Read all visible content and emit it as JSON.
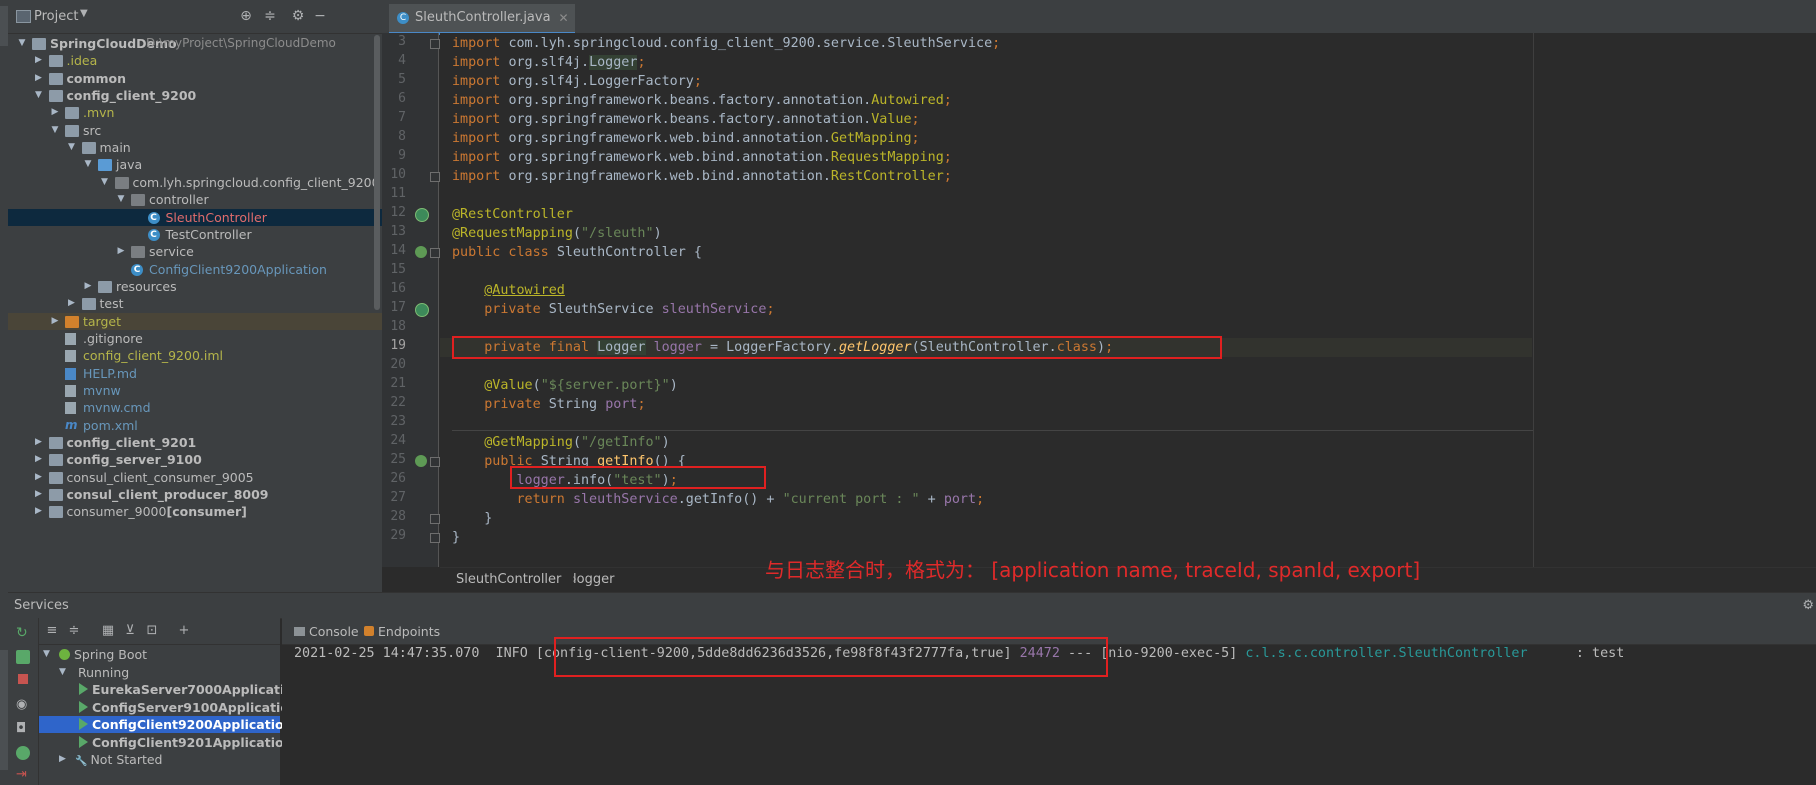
{
  "project_panel": {
    "title": "Project",
    "tree": [
      {
        "label": "SpringCloudDemo",
        "path": "D:\\myProject\\SpringCloudDemo",
        "depth": 0,
        "arrow": "▼",
        "icon": "folder",
        "bold": true,
        "color": "#bbbbbb"
      },
      {
        "label": ".idea",
        "depth": 1,
        "arrow": "▶",
        "icon": "folder",
        "color": "#b5b54a"
      },
      {
        "label": "common",
        "depth": 1,
        "arrow": "▶",
        "icon": "folder",
        "bold": true,
        "color": "#bbbbbb"
      },
      {
        "label": "config_client_9200",
        "depth": 1,
        "arrow": "▼",
        "icon": "folder",
        "bold": true,
        "color": "#bbbbbb"
      },
      {
        "label": ".mvn",
        "depth": 2,
        "arrow": "▶",
        "icon": "folder",
        "color": "#b5b54a"
      },
      {
        "label": "src",
        "depth": 2,
        "arrow": "▼",
        "icon": "folder",
        "color": "#bbbbbb"
      },
      {
        "label": "main",
        "depth": 3,
        "arrow": "▼",
        "icon": "folder",
        "color": "#bbbbbb"
      },
      {
        "label": "java",
        "depth": 4,
        "arrow": "▼",
        "icon": "folder-src",
        "color": "#bbbbbb"
      },
      {
        "label": "com.lyh.springcloud.config_client_9200",
        "depth": 5,
        "arrow": "▼",
        "icon": "package",
        "color": "#bbbbbb"
      },
      {
        "label": "controller",
        "depth": 6,
        "arrow": "▼",
        "icon": "package",
        "color": "#bbbbbb"
      },
      {
        "label": "SleuthController",
        "depth": 7,
        "arrow": "",
        "icon": "class",
        "color": "#e06c6c",
        "selected": true
      },
      {
        "label": "TestController",
        "depth": 7,
        "arrow": "",
        "icon": "class",
        "color": "#bbbbbb"
      },
      {
        "label": "service",
        "depth": 6,
        "arrow": "▶",
        "icon": "package",
        "color": "#bbbbbb"
      },
      {
        "label": "ConfigClient9200Application",
        "depth": 6,
        "arrow": "",
        "icon": "class",
        "color": "#6897bb"
      },
      {
        "label": "resources",
        "depth": 4,
        "arrow": "▶",
        "icon": "folder",
        "color": "#bbbbbb"
      },
      {
        "label": "test",
        "depth": 3,
        "arrow": "▶",
        "icon": "folder",
        "color": "#bbbbbb"
      },
      {
        "label": "target",
        "depth": 2,
        "arrow": "▶",
        "icon": "folder-orange",
        "color": "#b5b54a",
        "target": true
      },
      {
        "label": ".gitignore",
        "depth": 2,
        "arrow": "",
        "icon": "file",
        "color": "#bbbbbb"
      },
      {
        "label": "config_client_9200.iml",
        "depth": 2,
        "arrow": "",
        "icon": "file",
        "color": "#b5b54a"
      },
      {
        "label": "HELP.md",
        "depth": 2,
        "arrow": "",
        "icon": "file-md",
        "color": "#6897bb"
      },
      {
        "label": "mvnw",
        "depth": 2,
        "arrow": "",
        "icon": "file",
        "color": "#6897bb"
      },
      {
        "label": "mvnw.cmd",
        "depth": 2,
        "arrow": "",
        "icon": "file",
        "color": "#6897bb"
      },
      {
        "label": "pom.xml",
        "depth": 2,
        "arrow": "",
        "icon": "maven",
        "color": "#6897bb"
      },
      {
        "label": "config_client_9201",
        "depth": 1,
        "arrow": "▶",
        "icon": "folder",
        "bold": true,
        "color": "#bbbbbb"
      },
      {
        "label": "config_server_9100",
        "depth": 1,
        "arrow": "▶",
        "icon": "folder",
        "bold": true,
        "color": "#bbbbbb"
      },
      {
        "label": "consul_client_consumer_9005",
        "depth": 1,
        "arrow": "▶",
        "icon": "folder",
        "color": "#bbbbbb"
      },
      {
        "label": "consul_client_producer_8009",
        "depth": 1,
        "arrow": "▶",
        "icon": "folder",
        "bold": true,
        "color": "#bbbbbb"
      },
      {
        "label": "consumer_9000",
        "suffix": "[consumer]",
        "depth": 1,
        "arrow": "▶",
        "icon": "folder",
        "color": "#bbbbbb"
      }
    ]
  },
  "editor": {
    "tab_label": "SleuthController.java",
    "breadcrumb": [
      "SleuthController",
      "logger"
    ],
    "lines": [
      {
        "n": 3,
        "tokens": [
          [
            "kw",
            "import "
          ],
          [
            "",
            "com.lyh.springcloud.config_client_9200.service.SleuthService"
          ],
          [
            "kw",
            ";"
          ]
        ]
      },
      {
        "n": 4,
        "tokens": [
          [
            "kw",
            "import "
          ],
          [
            "",
            "org.slf4j."
          ],
          [
            "hl",
            "Logger"
          ],
          [
            "kw",
            ";"
          ]
        ]
      },
      {
        "n": 5,
        "tokens": [
          [
            "kw",
            "import "
          ],
          [
            "",
            "org.slf4j.LoggerFactory"
          ],
          [
            "kw",
            ";"
          ]
        ]
      },
      {
        "n": 6,
        "tokens": [
          [
            "kw",
            "import "
          ],
          [
            "",
            "org.springframework.beans.factory.annotation."
          ],
          [
            "ann",
            "Autowired"
          ],
          [
            "kw",
            ";"
          ]
        ]
      },
      {
        "n": 7,
        "tokens": [
          [
            "kw",
            "import "
          ],
          [
            "",
            "org.springframework.beans.factory.annotation."
          ],
          [
            "ann",
            "Value"
          ],
          [
            "kw",
            ";"
          ]
        ]
      },
      {
        "n": 8,
        "tokens": [
          [
            "kw",
            "import "
          ],
          [
            "",
            "org.springframework.web.bind.annotation."
          ],
          [
            "ann",
            "GetMapping"
          ],
          [
            "kw",
            ";"
          ]
        ]
      },
      {
        "n": 9,
        "tokens": [
          [
            "kw",
            "import "
          ],
          [
            "",
            "org.springframework.web.bind.annotation."
          ],
          [
            "ann",
            "RequestMapping"
          ],
          [
            "kw",
            ";"
          ]
        ]
      },
      {
        "n": 10,
        "tokens": [
          [
            "kw",
            "import "
          ],
          [
            "",
            "org.springframework.web.bind.annotation."
          ],
          [
            "ann",
            "RestController"
          ],
          [
            "kw",
            ";"
          ]
        ]
      },
      {
        "n": 11,
        "tokens": []
      },
      {
        "n": 12,
        "tokens": [
          [
            "ann",
            "@RestController"
          ]
        ]
      },
      {
        "n": 13,
        "tokens": [
          [
            "ann",
            "@RequestMapping"
          ],
          [
            "",
            "("
          ],
          [
            "str",
            "\"/sleuth\""
          ],
          [
            "",
            ")"
          ]
        ]
      },
      {
        "n": 14,
        "tokens": [
          [
            "kw",
            "public class "
          ],
          [
            "",
            "SleuthController {"
          ]
        ]
      },
      {
        "n": 15,
        "tokens": []
      },
      {
        "n": 16,
        "tokens": [
          [
            "",
            "    "
          ],
          [
            "annu",
            "@Autowired"
          ]
        ]
      },
      {
        "n": 17,
        "tokens": [
          [
            "",
            "    "
          ],
          [
            "kw",
            "private "
          ],
          [
            "",
            "SleuthService "
          ],
          [
            "fld",
            "sleuthService"
          ],
          [
            "kw",
            ";"
          ]
        ]
      },
      {
        "n": 18,
        "tokens": []
      },
      {
        "n": 19,
        "tokens": [
          [
            "",
            "    "
          ],
          [
            "kw",
            "private final "
          ],
          [
            "hl",
            "Logger"
          ],
          [
            "",
            " "
          ],
          [
            "fld",
            "logger"
          ],
          [
            "",
            " = LoggerFactory."
          ],
          [
            "itm",
            "getLogger"
          ],
          [
            "",
            "(SleuthController."
          ],
          [
            "kw",
            "class"
          ],
          [
            "",
            ")"
          ],
          [
            "kw",
            ";"
          ]
        ]
      },
      {
        "n": 20,
        "tokens": []
      },
      {
        "n": 21,
        "tokens": [
          [
            "",
            "    "
          ],
          [
            "ann",
            "@Value"
          ],
          [
            "",
            "("
          ],
          [
            "str",
            "\"${server.port}\""
          ],
          [
            "",
            ")"
          ]
        ]
      },
      {
        "n": 22,
        "tokens": [
          [
            "",
            "    "
          ],
          [
            "kw",
            "private "
          ],
          [
            "",
            "String "
          ],
          [
            "fld",
            "port"
          ],
          [
            "kw",
            ";"
          ]
        ]
      },
      {
        "n": 23,
        "tokens": []
      },
      {
        "n": 24,
        "tokens": [
          [
            "",
            "    "
          ],
          [
            "ann",
            "@GetMapping"
          ],
          [
            "",
            "("
          ],
          [
            "str",
            "\"/getInfo\""
          ],
          [
            "",
            ")"
          ]
        ]
      },
      {
        "n": 25,
        "tokens": [
          [
            "",
            "    "
          ],
          [
            "kw",
            "public "
          ],
          [
            "",
            "String "
          ],
          [
            "mth",
            "getInfo"
          ],
          [
            "",
            "() {"
          ]
        ]
      },
      {
        "n": 26,
        "tokens": [
          [
            "",
            "        "
          ],
          [
            "fld",
            "logger"
          ],
          [
            "",
            ".info("
          ],
          [
            "str",
            "\"test\""
          ],
          [
            "",
            ")"
          ],
          [
            "kw",
            ";"
          ]
        ]
      },
      {
        "n": 27,
        "tokens": [
          [
            "",
            "        "
          ],
          [
            "kw",
            "return "
          ],
          [
            "fld",
            "sleuthService"
          ],
          [
            "",
            ".getInfo() + "
          ],
          [
            "str",
            "\"current port : \""
          ],
          [
            "",
            " + "
          ],
          [
            "fld",
            "port"
          ],
          [
            "kw",
            ";"
          ]
        ]
      },
      {
        "n": 28,
        "tokens": [
          [
            "",
            "    }"
          ]
        ]
      },
      {
        "n": 29,
        "tokens": [
          [
            "",
            "}"
          ]
        ]
      }
    ],
    "annotation_note": "与日志整合时，格式为： [application name, traceId, spanId, export]",
    "annotation_color": "#e02a2a"
  },
  "services": {
    "title": "Services",
    "console_tab": "Console",
    "endpoints_tab": "Endpoints",
    "tree": [
      {
        "label": "Spring Boot",
        "depth": 0,
        "arrow": "▼"
      },
      {
        "label": "Running",
        "depth": 1,
        "arrow": "▼"
      },
      {
        "label": "EurekaServer7000Applicatio",
        "depth": 2,
        "run": true,
        "bold": true
      },
      {
        "label": "ConfigServer9100Applicatio",
        "depth": 2,
        "run": true,
        "bold": true
      },
      {
        "label": "ConfigClient9200Applicatio",
        "depth": 2,
        "run": true,
        "bold": true,
        "selected": true
      },
      {
        "label": "ConfigClient9201Applicatio",
        "depth": 2,
        "run": true,
        "bold": true
      },
      {
        "label": "Not Started",
        "depth": 1,
        "arrow": "▶"
      }
    ],
    "log": {
      "timestamp": "2021-02-25 14:47:35.070",
      "level": "INFO",
      "trace": "[config-client-9200,5dde8dd6236d3526,fe98f8f43f2777fa,true]",
      "pid": "24472",
      "sep": "---",
      "thread": "[nio-9200-exec-5]",
      "logger": "c.l.s.c.controller.SleuthController",
      "message": ": test"
    }
  },
  "icons": [
    "project-icon",
    "dropdown-icon",
    "locate-icon",
    "collapse-icon",
    "gear-icon",
    "hide-icon",
    "class-icon",
    "close-icon",
    "rerun-icon",
    "stop-icon",
    "expand-all-icon",
    "collapse-all-icon",
    "group-icon",
    "filter-icon",
    "open-icon",
    "add-icon",
    "console-icon",
    "endpoints-icon",
    "camera-icon",
    "debug-icon"
  ]
}
